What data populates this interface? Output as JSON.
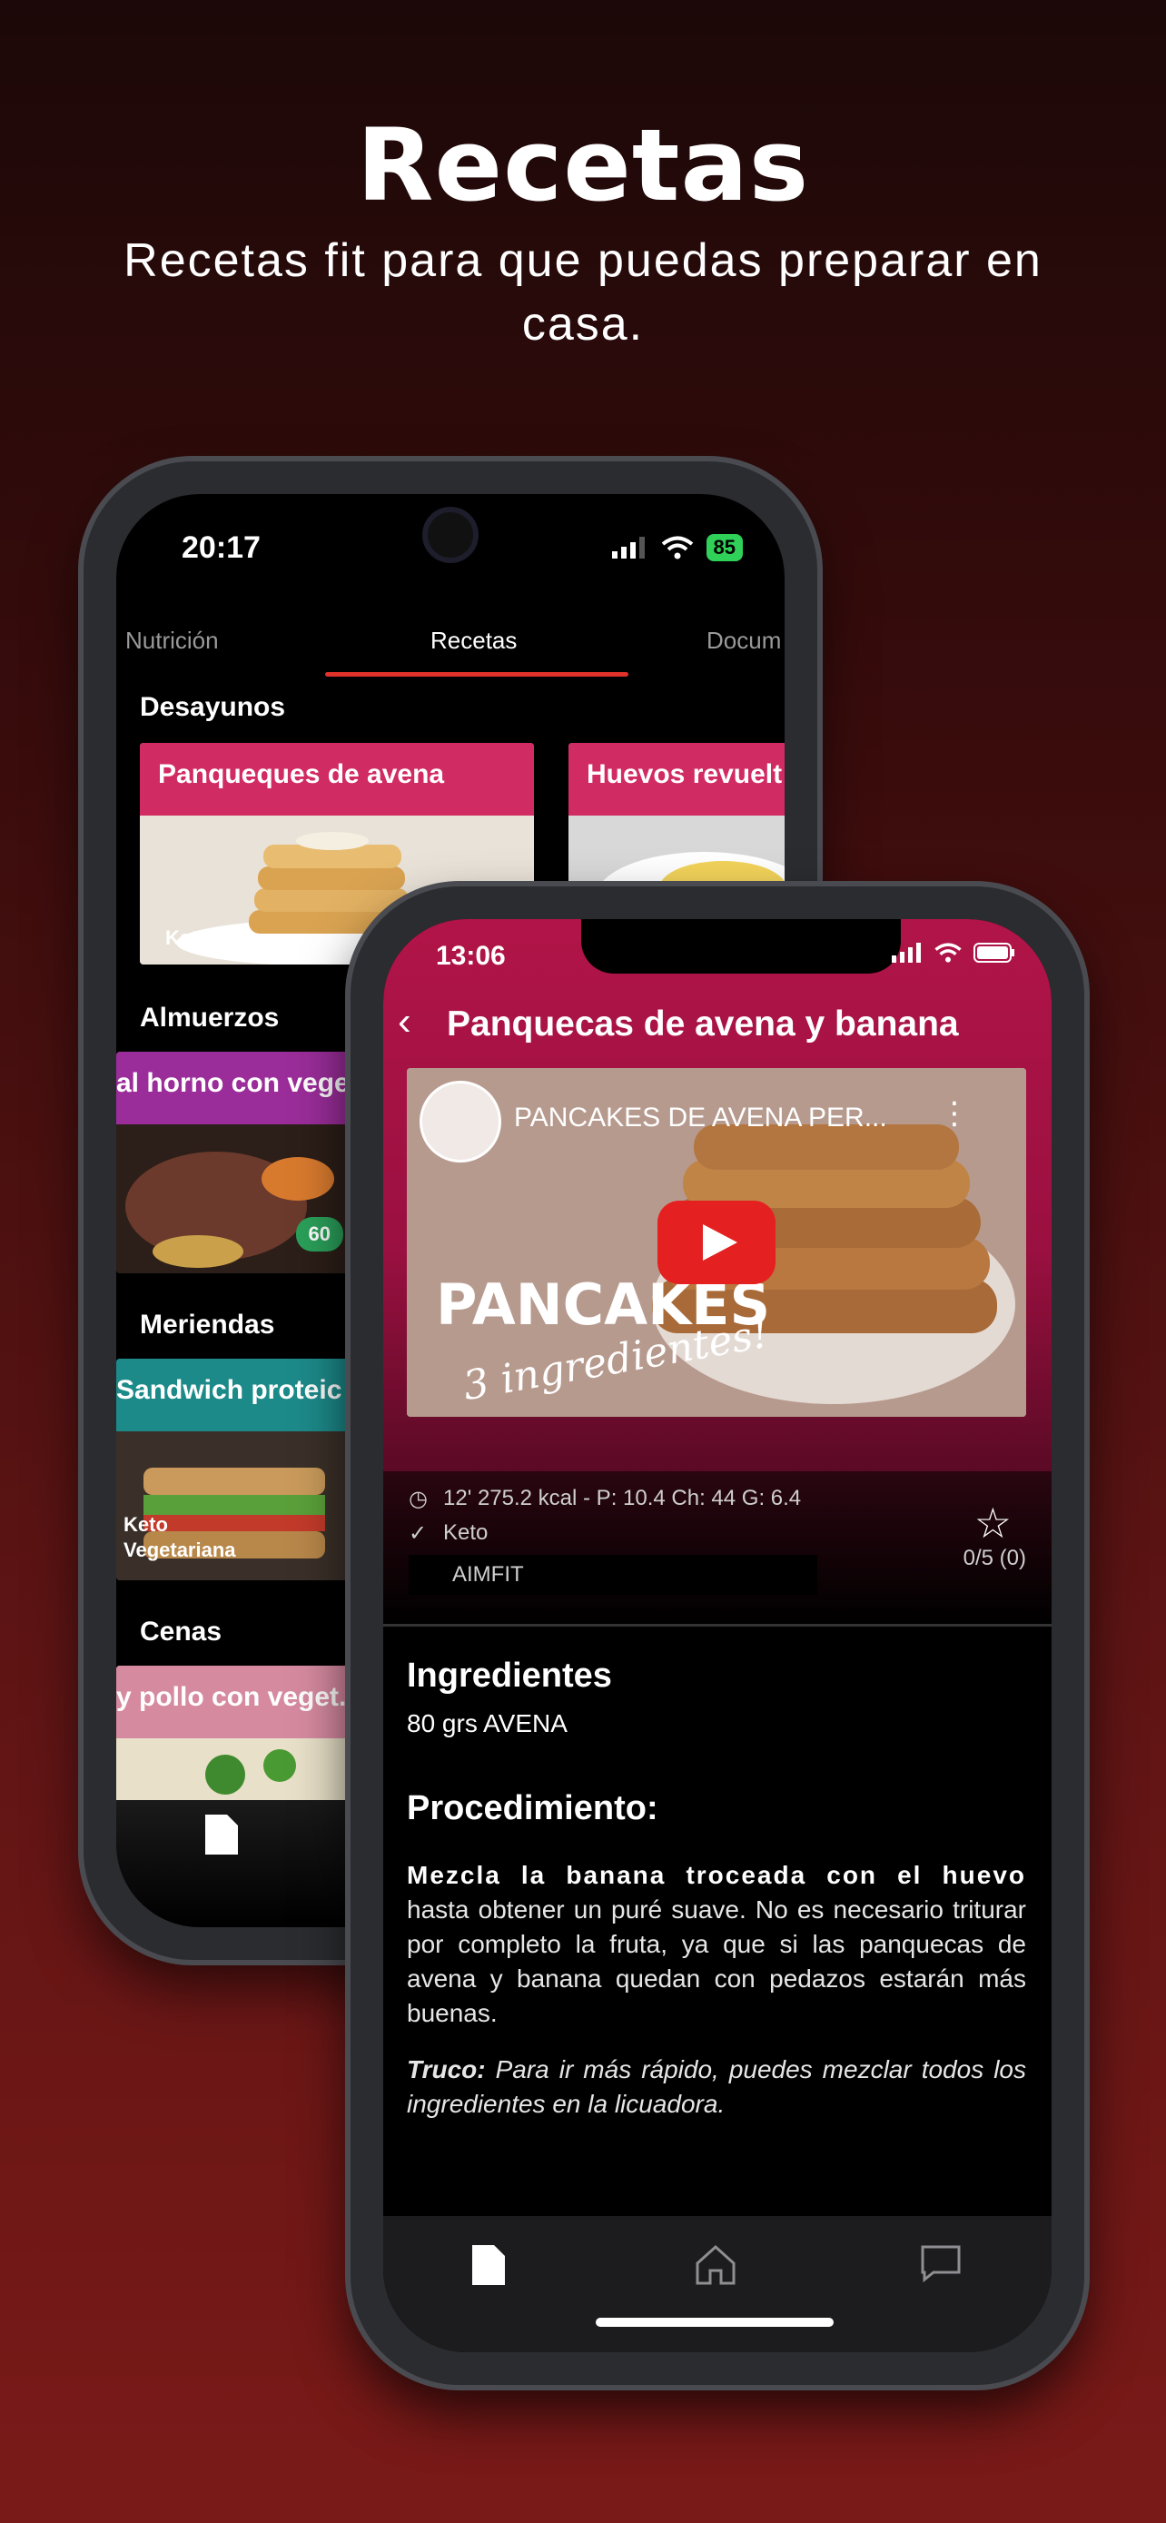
{
  "hero": {
    "title": "Recetas",
    "subtitle": "Recetas fit para que puedas preparar en casa."
  },
  "back_phone": {
    "status": {
      "time": "20:17",
      "battery": "85"
    },
    "tabs": [
      "Nutrición",
      "Recetas",
      "Docum"
    ],
    "sections": {
      "desayunos": {
        "label": "Desayunos",
        "cards": [
          {
            "title": "Panqueques de avena",
            "tag": "Keto"
          },
          {
            "title": "Huevos revuelt"
          }
        ]
      },
      "almuerzos": {
        "label": "Almuerzos",
        "cards": [
          {
            "title": "al horno con veget",
            "time": "60"
          }
        ]
      },
      "meriendas": {
        "label": "Meriendas",
        "cards": [
          {
            "title": "Sandwich proteic",
            "tag1": "Keto",
            "tag2": "Vegetariana"
          }
        ]
      },
      "cenas": {
        "label": "Cenas",
        "cards": [
          {
            "title": "y pollo con veget."
          }
        ]
      }
    }
  },
  "front_phone": {
    "status": {
      "time": "13:06"
    },
    "title": "Panquecas de avena y banana",
    "video": {
      "title": "PANCAKES DE AVENA PER...",
      "overlay_main": "PANCAKES",
      "overlay_script": "3 ingredientes!"
    },
    "meta": {
      "stats": "12' 275.2 kcal - P: 10.4 Ch: 44 G: 6.4",
      "diet": "Keto",
      "author": "AIMFIT",
      "rating": "0/5 (0)"
    },
    "ingredients": {
      "heading": "Ingredientes",
      "items": [
        "80 grs AVENA"
      ]
    },
    "procedure": {
      "heading": "Procedimiento:",
      "bold_text": "Mezcla la banana troceada con el huevo",
      "text": " hasta obtener un puré suave. No es necesario triturar por completo la fruta, ya que si las panquecas de avena y banana quedan con pedazos estarán más buenas.",
      "tip_label": "Truco:",
      "tip_text": " Para ir más rápido, puedes mezclar todos los ingredientes en la licuadora."
    }
  },
  "colors": {
    "accent": "#e0322b",
    "header": "#b11448",
    "badge": "#2aa05a"
  }
}
